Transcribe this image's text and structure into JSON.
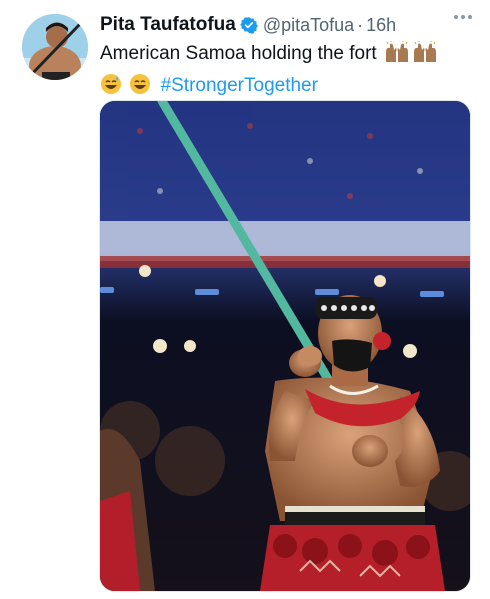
{
  "tweet": {
    "author_name": "Pita Taufatofua",
    "handle": "@pitaTofua",
    "separator": "·",
    "time": "16h",
    "text": "American Samoa holding the fort",
    "hashtag": "#StrongerTogether",
    "verified_icon": "verified-badge-icon",
    "more_icon": "more-dots-icon",
    "colors": {
      "link": "#1d9bf0",
      "verified": "#1d9bf0",
      "secondary": "#536471"
    }
  }
}
